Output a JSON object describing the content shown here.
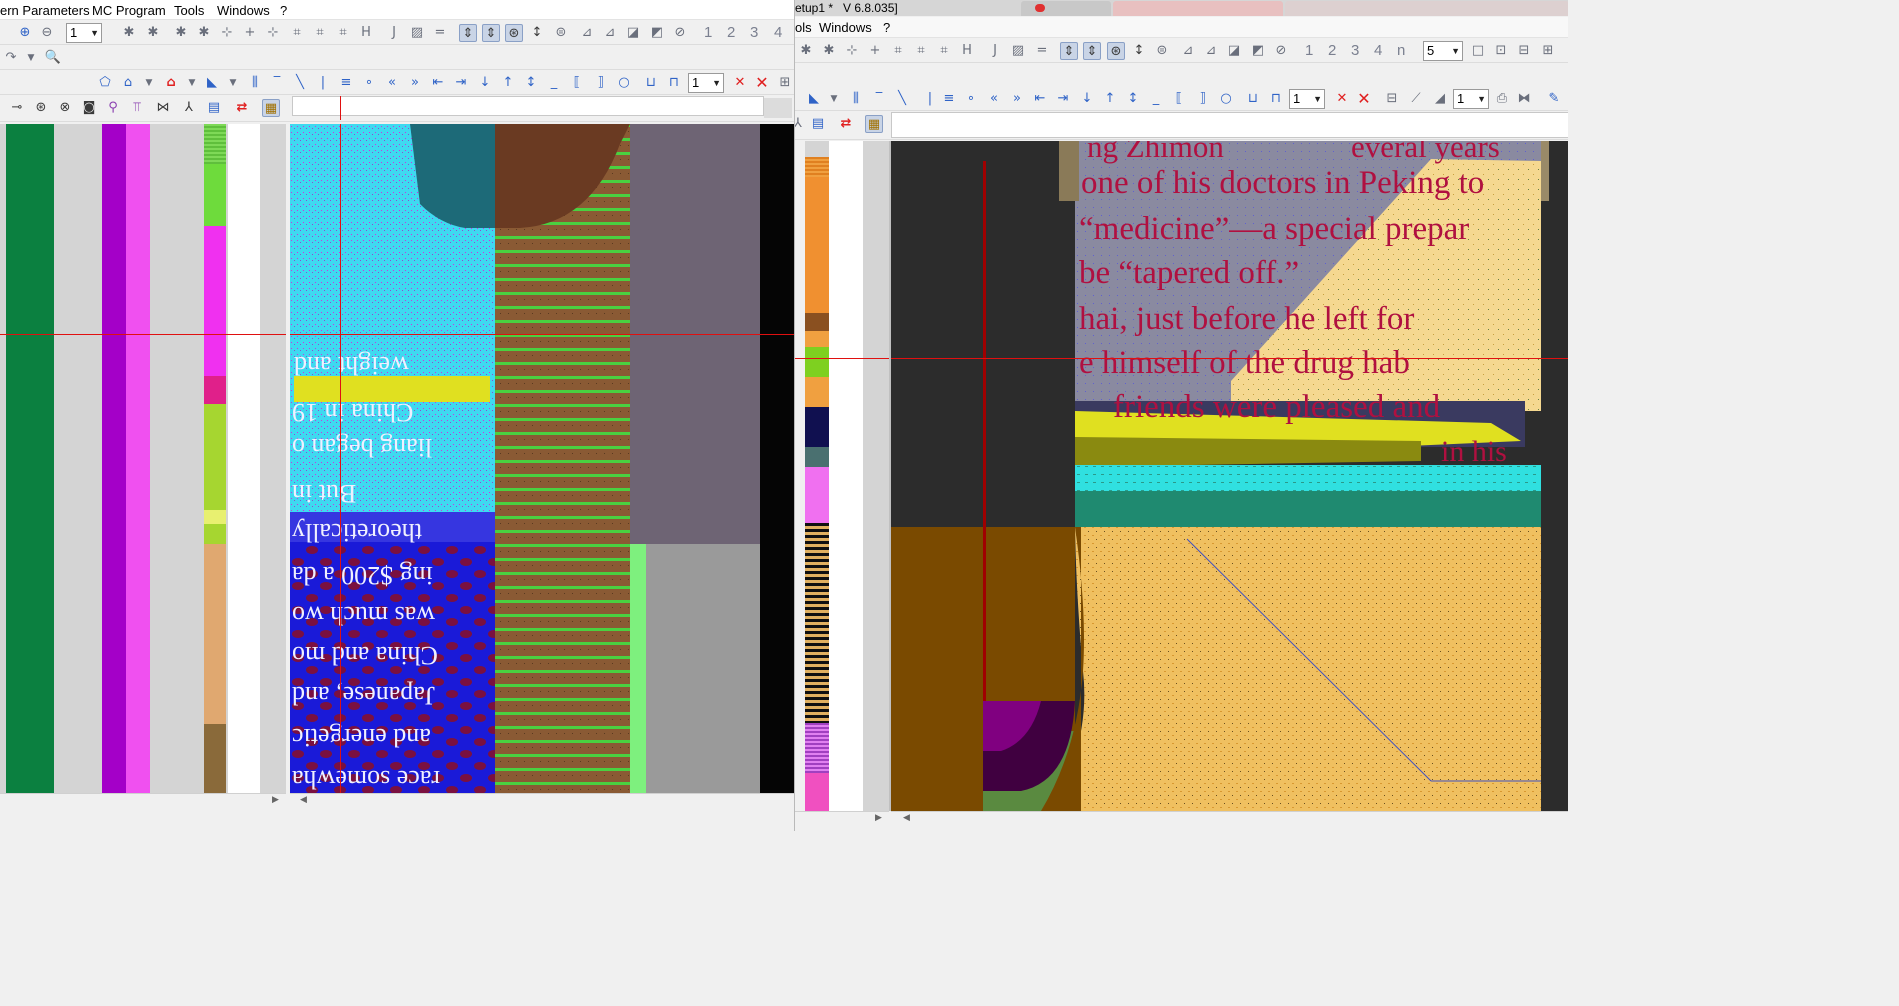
{
  "left_window": {
    "menu": [
      "ern Parameters",
      "MC Program",
      "Tools",
      "Windows",
      "?"
    ],
    "toolbar1": {
      "zoom_value": "1",
      "numbers": [
        "1",
        "2",
        "3",
        "4"
      ]
    },
    "toolbar3": {
      "layer_value": "1"
    },
    "page_text": {
      "line1": "weight and",
      "line2": "China in 19",
      "line3": "liang began o",
      "line4": "But in",
      "line5": "theoretically",
      "line6": "ing $200 a da",
      "line7": "was much wo",
      "line8": "China and mo",
      "line9": "Japanese, and",
      "line10": "and energetic",
      "line11": "race somewha"
    },
    "strip_colors": [
      "#0b8040",
      "#d4d4d4",
      "#a400c8",
      "#f050f0",
      "#d4d4d4"
    ]
  },
  "right_window": {
    "title": "etup1 *",
    "version": "V 6.8.035]",
    "menu": [
      "ols",
      "Windows",
      "?"
    ],
    "toolbar1": {
      "numbers": [
        "1",
        "2",
        "3",
        "4",
        "n"
      ],
      "count_value": "5"
    },
    "toolbar2": {
      "layer_value": "1",
      "layer_value2": "1"
    },
    "page_text": {
      "line0": "ng Zhimon",
      "line0b": "everal years",
      "line1": "one of his doctors in Peking to",
      "line2": "“medicine”—a special prepar",
      "line3": "be “tapered off.”",
      "line4": "hai, just before he left for",
      "line5": "e himself of the drug hab",
      "line6": "friends were pleased and",
      "line7": "in his"
    }
  }
}
